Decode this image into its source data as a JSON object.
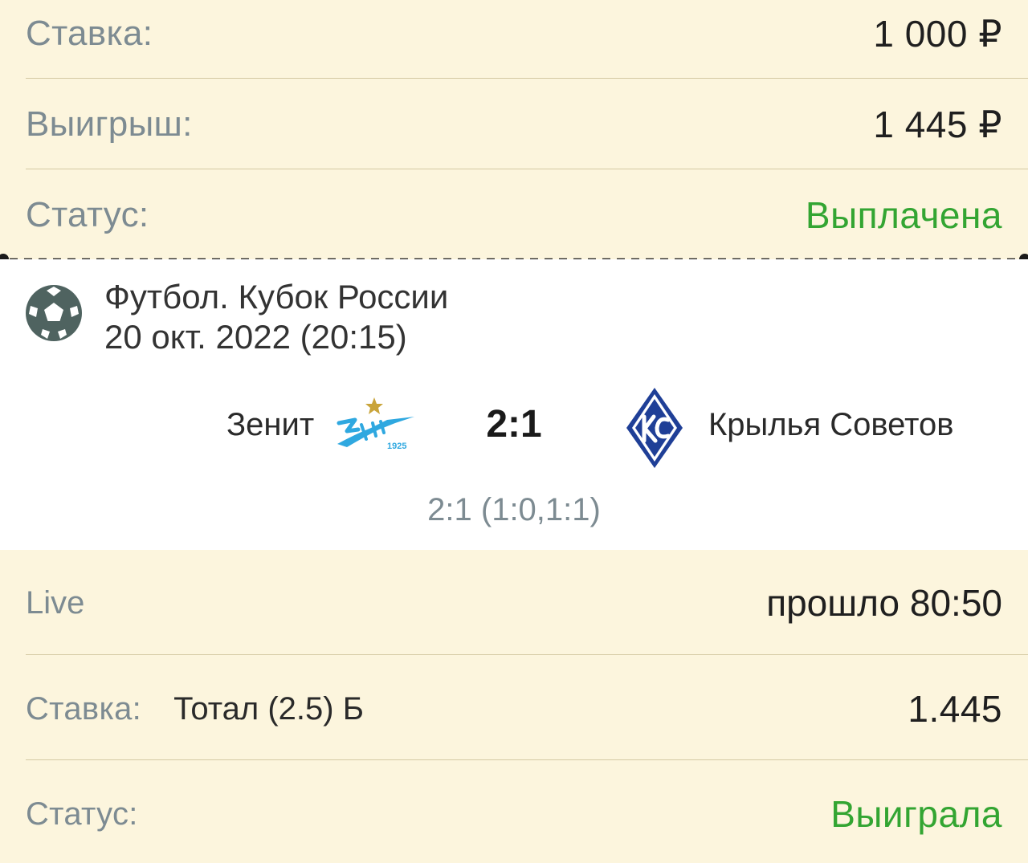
{
  "summary": {
    "stake_label": "Ставка:",
    "stake_value": "1 000 ₽",
    "win_label": "Выигрыш:",
    "win_value": "1 445 ₽",
    "status_label": "Статус:",
    "status_value": "Выплачена"
  },
  "event": {
    "sport_icon": "soccer-ball-icon",
    "title": "Футбол. Кубок России",
    "datetime": "20 окт. 2022 (20:15)",
    "home_team": "Зенит",
    "home_logo": "zenit-logo-icon",
    "home_logo_text": "Зенит 1925",
    "score": "2:1",
    "away_logo": "krylia-sovetov-logo-icon",
    "away_team": "Крылья Советов",
    "score_detail": "2:1 (1:0,1:1)"
  },
  "bet": {
    "live_label": "Live",
    "live_value": "прошло 80:50",
    "bet_label": "Ставка:",
    "bet_type": "Тотал (2.5) Б",
    "odds": "1.445",
    "status_label": "Статус:",
    "status_value": "Выиграла"
  },
  "colors": {
    "background": "#fcf5dd",
    "card": "#ffffff",
    "label": "#7d8b92",
    "success": "#33a532",
    "zenit_blue": "#2fa8e0",
    "ks_blue": "#1f3f97"
  }
}
